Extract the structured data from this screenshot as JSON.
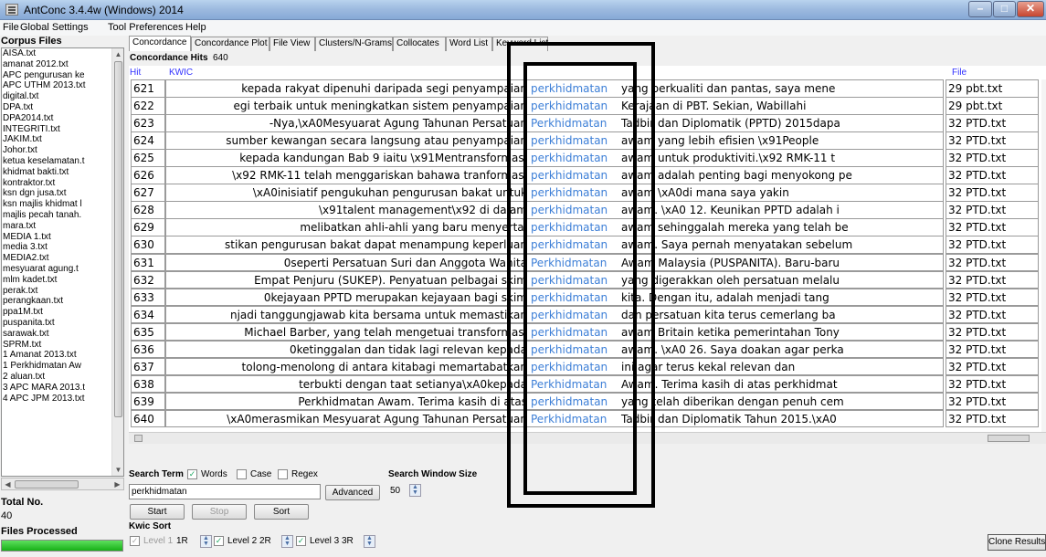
{
  "window": {
    "title": "AntConc 3.4.4w (Windows) 2014",
    "min": "–",
    "max": "□",
    "close": "✕"
  },
  "menu": [
    "File",
    "Global Settings",
    "Tool Preferences",
    "Help"
  ],
  "sidebar": {
    "header": "Corpus Files",
    "files": [
      "AISA.txt",
      "amanat 2012.txt",
      "APC pengurusan ke",
      "APC UTHM 2013.txt",
      "digital.txt",
      "DPA.txt",
      "DPA2014.txt",
      "INTEGRITI.txt",
      "JAKIM.txt",
      "Johor.txt",
      "ketua keselamatan.t",
      "khidmat bakti.txt",
      "kontraktor.txt",
      "ksn dgn jusa.txt",
      "ksn majlis khidmat l",
      "majlis pecah tanah.",
      "mara.txt",
      "MEDIA 1.txt",
      "media 3.txt",
      "MEDIA2.txt",
      "mesyuarat agung.t",
      "mlm kadet.txt",
      "perak.txt",
      "perangkaan.txt",
      "ppa1M.txt",
      "puspanita.txt",
      "sarawak.txt",
      "SPRM.txt",
      "1 Amanat 2013.txt",
      "1 Perkhidmatan Aw",
      "2 aluan.txt",
      "3 APC MARA 2013.t",
      "4 APC JPM 2013.txt"
    ],
    "total_label": "Total No.",
    "total_value": "40",
    "files_processed_label": "Files Processed",
    "files_processed_fraction": 1.0
  },
  "tabs": [
    "Concordance",
    "Concordance Plot",
    "File View",
    "Clusters/N-Grams",
    "Collocates",
    "Word List",
    "Keyword List"
  ],
  "active_tab": 0,
  "concordance": {
    "hits_label": "Concordance Hits",
    "hits_value": "640",
    "col_hit": "Hit",
    "col_kwic": "KWIC",
    "col_file": "File",
    "rows": [
      {
        "hit": "621",
        "left": "kepada rakyat dipenuhi daripada segi penyampaian",
        "key": "perkhidmatan",
        "right": "yang berkualiti dan pantas, saya mene",
        "file": "29 pbt.txt"
      },
      {
        "hit": "622",
        "left": "egi terbaik untuk meningkatkan sistem penyampaian",
        "key": "perkhidmatan",
        "right": "Kerajaan di PBT.  Sekian, Wabillahi",
        "file": "29 pbt.txt"
      },
      {
        "hit": "623",
        "left": "-Nya,\\xA0Mesyuarat Agung Tahunan Persatuan",
        "key": "Perkhidmatan",
        "right": "Tadbir dan Diplomatik (PPTD) 2015dapa",
        "file": "32 PTD.txt"
      },
      {
        "hit": "624",
        "left": "sumber kewangan secara langsung atau penyampaian",
        "key": "perkhidmatan",
        "right": "awam yang lebih efisien \\x91People",
        "file": "32 PTD.txt"
      },
      {
        "hit": "625",
        "left": "kepada kandungan Bab 9 iaitu \\x91Mentransformasi",
        "key": "perkhidmatan",
        "right": "awam untuk produktiviti.\\x92 RMK-11 t",
        "file": "32 PTD.txt"
      },
      {
        "hit": "626",
        "left": "\\x92 RMK-11 telah menggariskan bahawa tranformasi",
        "key": "perkhidmatan",
        "right": "awam adalah penting bagi menyokong pe",
        "file": "32 PTD.txt"
      },
      {
        "hit": "627",
        "left": "\\xA0inisiatif pengukuhan pengurusan bakat untuk",
        "key": "perkhidmatan",
        "right": "awam \\xA0di mana saya yakin",
        "file": "32 PTD.txt"
      },
      {
        "hit": "628",
        "left": "\\x91talent management\\x92 di dalam",
        "key": "perkhidmatan",
        "right": "awam. \\xA0 12. Keunikan PPTD adalah i",
        "file": "32 PTD.txt"
      },
      {
        "hit": "629",
        "left": "melibatkan ahli-ahli yang baru menyertai",
        "key": "perkhidmatan",
        "right": "awam sehinggalah mereka yang telah be",
        "file": "32 PTD.txt"
      },
      {
        "hit": "630",
        "left": "stikan pengurusan bakat dapat menampung keperluan",
        "key": "perkhidmatan",
        "right": "awam. Saya pernah menyatakan sebelum",
        "file": "32 PTD.txt"
      },
      {
        "hit": "631",
        "left": "0seperti Persatuan Suri dan Anggota Wanita",
        "key": "Perkhidmatan",
        "right": "Awam Malaysia (PUSPANITA). Baru-baru",
        "file": "32 PTD.txt"
      },
      {
        "hit": "632",
        "left": "Empat Penjuru (SUKEP). Penyatuan pelbagai skim",
        "key": "perkhidmatan",
        "right": "yang digerakkan oleh persatuan melalu",
        "file": "32 PTD.txt"
      },
      {
        "hit": "633",
        "left": "0kejayaan PPTD merupakan kejayaan bagi skim",
        "key": "perkhidmatan",
        "right": "kita. Dengan itu, adalah menjadi tang",
        "file": "32 PTD.txt"
      },
      {
        "hit": "634",
        "left": "njadi tanggungjawab kita bersama untuk memastikan",
        "key": "perkhidmatan",
        "right": "dan persatuan kita terus cemerlang ba",
        "file": "32 PTD.txt"
      },
      {
        "hit": "635",
        "left": "Michael Barber, yang telah mengetuai transformasi",
        "key": "perkhidmatan",
        "right": "awam Britain ketika pemerintahan Tony",
        "file": "32 PTD.txt"
      },
      {
        "hit": "636",
        "left": "0ketinggalan dan tidak lagi relevan kepada",
        "key": "perkhidmatan",
        "right": "awam. \\xA0 26. Saya doakan agar perka",
        "file": "32 PTD.txt"
      },
      {
        "hit": "637",
        "left": "tolong-menolong di antara kitabagi memartabatkan",
        "key": "perkhidmatan",
        "right": "ini agar terus kekal relevan dan",
        "file": "32 PTD.txt"
      },
      {
        "hit": "638",
        "left": "terbukti dengan taat setianya\\xA0kepada",
        "key": "Perkhidmatan",
        "right": "Awam. Terima kasih di atas perkhidmat",
        "file": "32 PTD.txt"
      },
      {
        "hit": "639",
        "left": "Perkhidmatan Awam. Terima kasih di atas",
        "key": "perkhidmatan",
        "right": "yang telah diberikan dengan penuh cem",
        "file": "32 PTD.txt"
      },
      {
        "hit": "640",
        "left": "\\xA0merasmikan Mesyuarat Agung Tahunan Persatuan",
        "key": "Perkhidmatan",
        "right": "Tadbir dan Diplomatik Tahun 2015.\\xA0",
        "file": "32 PTD.txt"
      }
    ]
  },
  "search": {
    "term_label": "Search Term",
    "words_label": "Words",
    "words_checked": true,
    "case_label": "Case",
    "case_checked": false,
    "regex_label": "Regex",
    "regex_checked": false,
    "window_size_label": "Search Window Size",
    "window_size_value": "50",
    "query": "perkhidmatan",
    "advanced_label": "Advanced",
    "start_label": "Start",
    "stop_label": "Stop",
    "sort_label": "Sort"
  },
  "kwic_sort": {
    "label": "Kwic Sort",
    "level1_label": "Level 1",
    "level1_value": "1R",
    "level2_label": "Level 2",
    "level2_value": "2R",
    "level3_label": "Level 3",
    "level3_value": "3R"
  },
  "clone_label": "Clone Results"
}
